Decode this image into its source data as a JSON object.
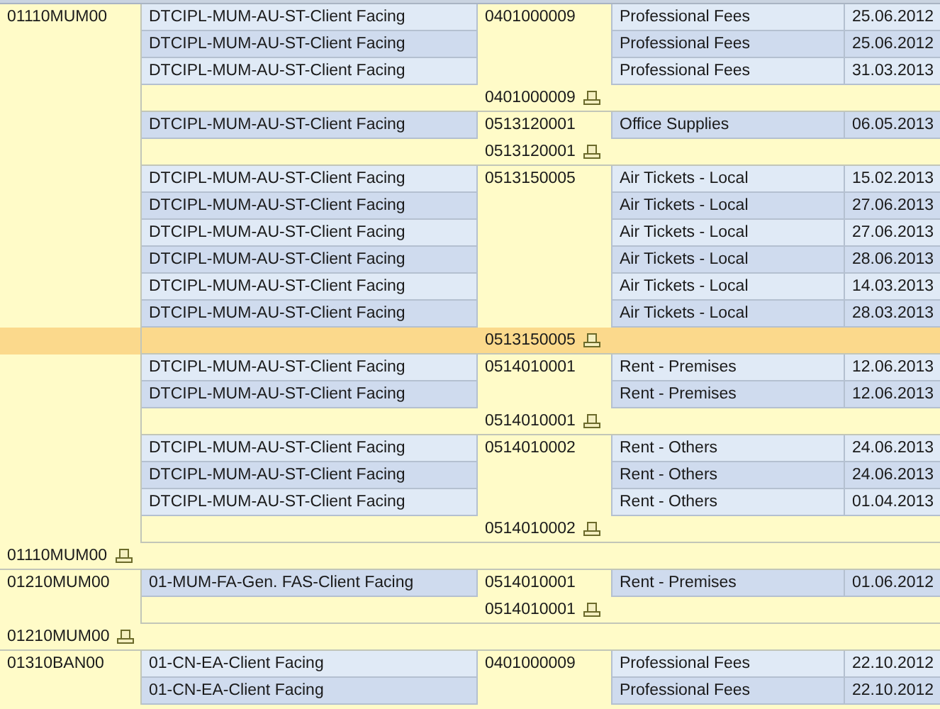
{
  "groups": [
    {
      "company": "01110MUM00",
      "accounts": [
        {
          "account": "0401000009",
          "rows": [
            {
              "cost_center": "DTCIPL-MUM-AU-ST-Client Facing",
              "description": "Professional Fees",
              "date": "25.06.2012"
            },
            {
              "cost_center": "DTCIPL-MUM-AU-ST-Client Facing",
              "description": "Professional Fees",
              "date": "25.06.2012"
            },
            {
              "cost_center": "DTCIPL-MUM-AU-ST-Client Facing",
              "description": "Professional Fees",
              "date": "31.03.2013"
            }
          ],
          "subtotal": {
            "label": "0401000009",
            "selected": false
          }
        },
        {
          "account": "0513120001",
          "rows": [
            {
              "cost_center": "DTCIPL-MUM-AU-ST-Client Facing",
              "description": "Office Supplies",
              "date": "06.05.2013"
            }
          ],
          "subtotal": {
            "label": "0513120001",
            "selected": false
          }
        },
        {
          "account": "0513150005",
          "rows": [
            {
              "cost_center": "DTCIPL-MUM-AU-ST-Client Facing",
              "description": "Air Tickets - Local",
              "date": "15.02.2013"
            },
            {
              "cost_center": "DTCIPL-MUM-AU-ST-Client Facing",
              "description": "Air Tickets - Local",
              "date": "27.06.2013"
            },
            {
              "cost_center": "DTCIPL-MUM-AU-ST-Client Facing",
              "description": "Air Tickets - Local",
              "date": "27.06.2013"
            },
            {
              "cost_center": "DTCIPL-MUM-AU-ST-Client Facing",
              "description": "Air Tickets - Local",
              "date": "28.06.2013"
            },
            {
              "cost_center": "DTCIPL-MUM-AU-ST-Client Facing",
              "description": "Air Tickets - Local",
              "date": "14.03.2013"
            },
            {
              "cost_center": "DTCIPL-MUM-AU-ST-Client Facing",
              "description": "Air Tickets - Local",
              "date": "28.03.2013"
            }
          ],
          "subtotal": {
            "label": "0513150005",
            "selected": true
          }
        },
        {
          "account": "0514010001",
          "rows": [
            {
              "cost_center": "DTCIPL-MUM-AU-ST-Client Facing",
              "description": "Rent - Premises",
              "date": "12.06.2013"
            },
            {
              "cost_center": "DTCIPL-MUM-AU-ST-Client Facing",
              "description": "Rent - Premises",
              "date": "12.06.2013"
            }
          ],
          "subtotal": {
            "label": "0514010001",
            "selected": false
          }
        },
        {
          "account": "0514010002",
          "rows": [
            {
              "cost_center": "DTCIPL-MUM-AU-ST-Client Facing",
              "description": "Rent - Others",
              "date": "24.06.2013"
            },
            {
              "cost_center": "DTCIPL-MUM-AU-ST-Client Facing",
              "description": "Rent - Others",
              "date": "24.06.2013"
            },
            {
              "cost_center": "DTCIPL-MUM-AU-ST-Client Facing",
              "description": "Rent - Others",
              "date": "01.04.2013"
            }
          ],
          "subtotal": {
            "label": "0514010002",
            "selected": false
          }
        }
      ],
      "subtotal": {
        "label": "01110MUM00",
        "selected": false
      }
    },
    {
      "company": "01210MUM00",
      "accounts": [
        {
          "account": "0514010001",
          "rows": [
            {
              "cost_center": "01-MUM-FA-Gen. FAS-Client Facing",
              "description": "Rent - Premises",
              "date": "01.06.2012"
            }
          ],
          "subtotal": {
            "label": "0514010001",
            "selected": false
          }
        }
      ],
      "subtotal": {
        "label": "01210MUM00",
        "selected": false
      }
    },
    {
      "company": "01310BAN00",
      "accounts": [
        {
          "account": "0401000009",
          "rows": [
            {
              "cost_center": "01-CN-EA-Client Facing",
              "description": "Professional Fees",
              "date": "22.10.2012"
            },
            {
              "cost_center": "01-CN-EA-Client Facing",
              "description": "Professional Fees",
              "date": "22.10.2012"
            }
          ]
        }
      ]
    }
  ]
}
